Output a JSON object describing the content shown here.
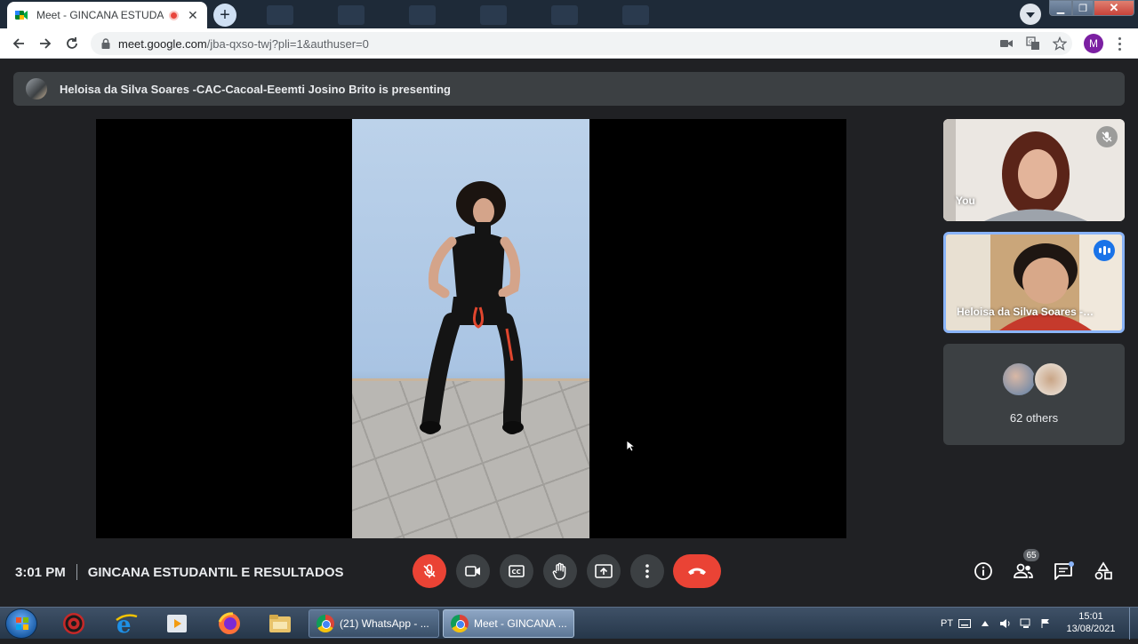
{
  "browser": {
    "tab_title": "Meet - GINCANA ESTUDANTIL E RESULTADOS",
    "tab_close": "✕",
    "new_tab": "+",
    "url_domain": "meet.google.com",
    "url_path": "/jba-qxso-twj?pli=1&authuser=0",
    "profile_initial": "M",
    "window_min": "▁",
    "window_max": "❐",
    "window_close": "✕"
  },
  "meet": {
    "presenting_banner": "Heloisa da Silva Soares -CAC-Cacoal-Eeemti Josino Brito is presenting",
    "self_name": "You",
    "speaker_name": "Heloisa da Silva Soares -CAC-Cacoal-Eeemti Josino Brito",
    "others_label": "62 others",
    "clock": "3:01 PM",
    "meeting_title": "GINCANA ESTUDANTIL E RESULTADOS",
    "participant_count": "65"
  },
  "taskbar": {
    "tasks": [
      {
        "label": "(21) WhatsApp - ...",
        "active": false
      },
      {
        "label": "Meet - GINCANA ...",
        "active": true
      }
    ],
    "language": "PT",
    "time": "15:01",
    "date": "13/08/2021"
  },
  "colors": {
    "meet_bg": "#202124",
    "tile_bg": "#3c4043",
    "danger_red": "#ea4335",
    "speaking_blue": "#1a73e8",
    "highlight_border": "#8ab4f8"
  }
}
